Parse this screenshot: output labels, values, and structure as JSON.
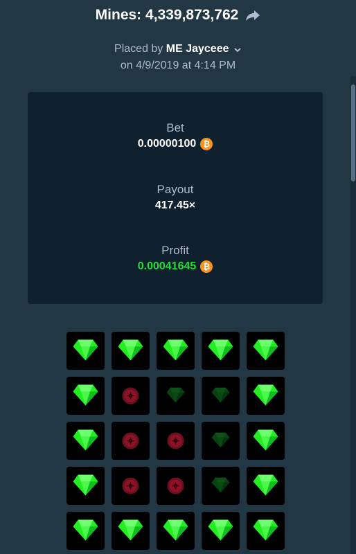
{
  "header": {
    "title": "Mines: 4,339,873,762",
    "placed_prefix": "Placed by",
    "user": "ME Jayceee",
    "date": "on 4/9/2019 at 4:14 PM"
  },
  "stats": {
    "bet_label": "Bet",
    "bet_value": "0.00000100",
    "payout_label": "Payout",
    "payout_value": "417.45×",
    "profit_label": "Profit",
    "profit_value": "0.00041645",
    "currency_icon": "bitcoin-icon",
    "profit_color": "#1fde34",
    "currency_color": "#f7931a"
  },
  "board": {
    "rows": [
      [
        "gem",
        "gem",
        "gem",
        "gem",
        "gem"
      ],
      [
        "gem",
        "mine-dim",
        "gem-dim",
        "gem-dim",
        "gem"
      ],
      [
        "gem",
        "mine-dim",
        "mine-dim",
        "gem-dim",
        "gem"
      ],
      [
        "gem",
        "mine-dim",
        "mine-dim",
        "gem-dim",
        "gem"
      ],
      [
        "gem",
        "gem",
        "gem",
        "gem",
        "gem"
      ]
    ]
  }
}
